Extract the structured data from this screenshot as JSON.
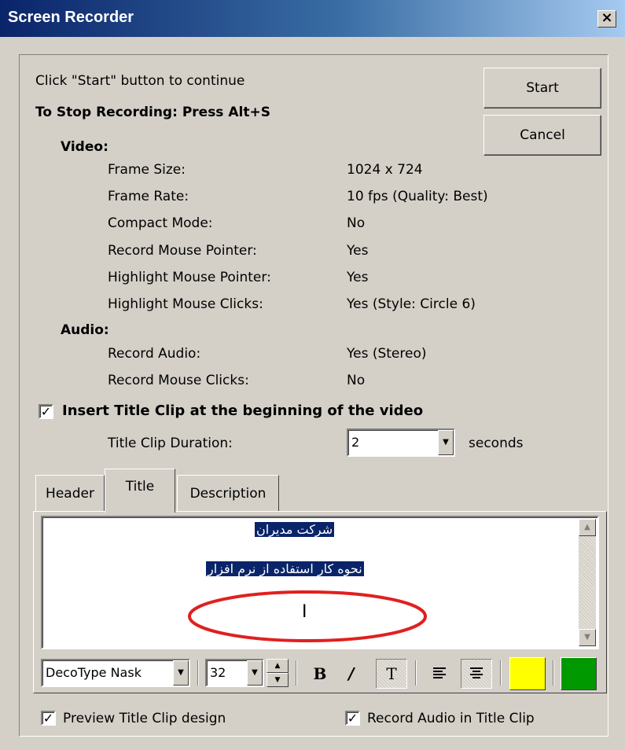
{
  "window": {
    "title": "Screen Recorder",
    "close_glyph": "×"
  },
  "info": {
    "instruction": "Click \"Start\" button to continue",
    "stop_hint": "To Stop Recording: Press Alt+S"
  },
  "buttons": {
    "start": "Start",
    "cancel": "Cancel"
  },
  "video": {
    "heading": "Video:",
    "rows": [
      {
        "label": "Frame Size:",
        "value": "1024 x 724"
      },
      {
        "label": "Frame Rate:",
        "value": "10 fps (Quality: Best)"
      },
      {
        "label": "Compact Mode:",
        "value": "No"
      },
      {
        "label": "Record Mouse Pointer:",
        "value": "Yes"
      },
      {
        "label": "Highlight Mouse Pointer:",
        "value": "Yes"
      },
      {
        "label": "Highlight Mouse Clicks:",
        "value": "Yes (Style: Circle 6)"
      }
    ]
  },
  "audio": {
    "heading": "Audio:",
    "rows": [
      {
        "label": "Record Audio:",
        "value": "Yes (Stereo)"
      },
      {
        "label": "Record Mouse Clicks:",
        "value": "No"
      }
    ]
  },
  "title_clip": {
    "insert_label": "Insert Title Clip at the beginning of the video",
    "insert_checked": true,
    "duration_label": "Title Clip Duration:",
    "duration_value": "2",
    "duration_unit": "seconds"
  },
  "tabs": [
    {
      "label": "Header",
      "active": false
    },
    {
      "label": "Title",
      "active": true
    },
    {
      "label": "Description",
      "active": false
    }
  ],
  "editor": {
    "line1": "شرکت مدیران",
    "line2": "نحوه کار استفاده از نرم افزار",
    "cursor_glyph": "I",
    "annotation_color": "#e02020"
  },
  "toolbar": {
    "font_name": "DecoType Nask",
    "font_size": "32",
    "bold_glyph": "B",
    "italic_glyph": "/",
    "shadow_glyph": "T",
    "text_color": "#ffff00",
    "back_color": "#009900"
  },
  "footer": {
    "preview_label": "Preview Title Clip design",
    "preview_checked": true,
    "record_audio_label": "Record Audio in Title Clip",
    "record_audio_checked": true
  }
}
